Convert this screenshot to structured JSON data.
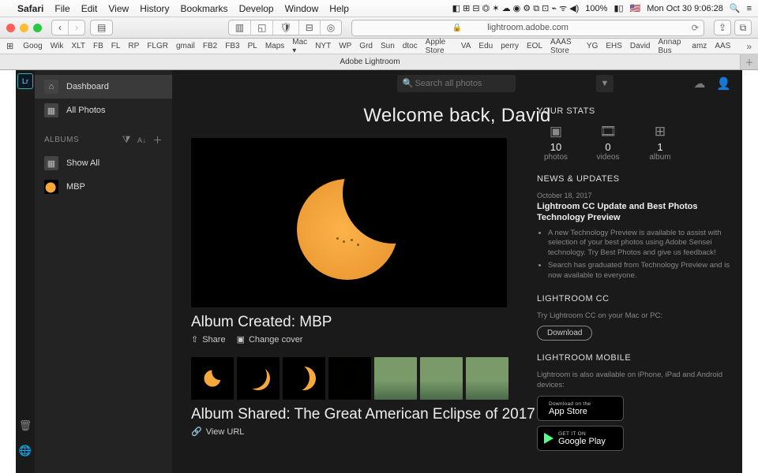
{
  "macmenu": {
    "appname": "Safari",
    "items": [
      "File",
      "Edit",
      "View",
      "History",
      "Bookmarks",
      "Develop",
      "Window",
      "Help"
    ],
    "battery": "100%",
    "flag": "🇺🇸",
    "datetime": "Mon Oct 30  9:06:28"
  },
  "safari": {
    "url": "lightroom.adobe.com",
    "tab_title": "Adobe Lightroom",
    "bookmarks": [
      "Goog",
      "Wik",
      "XLT",
      "FB",
      "FL",
      "RP",
      "FLGR",
      "gmail",
      "FB2",
      "FB3",
      "PL",
      "Maps",
      "Mac ▾",
      "NYT",
      "WP",
      "Grd",
      "Sun",
      "dtoc",
      "Apple Store",
      "VA",
      "Edu",
      "perry",
      "EOL",
      "AAAS Store",
      "YG",
      "EHS",
      "David",
      "Annap Bus",
      "amz",
      "AAS"
    ]
  },
  "app": {
    "logo": "Lr",
    "search_placeholder": "Search all photos"
  },
  "sidebar": {
    "dashboard": "Dashboard",
    "allphotos": "All Photos",
    "albums_hdr": "ALBUMS",
    "showall": "Show All",
    "album1": "MBP"
  },
  "feed": {
    "welcome": "Welcome back, David",
    "card1_title": "Album Created: MBP",
    "share": "Share",
    "change_cover": "Change cover",
    "card2_title": "Album Shared: The Great American Eclipse of 2017",
    "view_url": "View URL"
  },
  "stats": {
    "title": "YOUR STATS",
    "photos_n": "10",
    "photos_l": "photos",
    "videos_n": "0",
    "videos_l": "videos",
    "albums_n": "1",
    "albums_l": "album"
  },
  "news": {
    "title": "NEWS & UPDATES",
    "date": "October 18, 2017",
    "headline": "Lightroom CC Update and Best Photos Technology Preview",
    "b1": "A new Technology Preview is available to assist with selection of your best photos using Adobe Sensei technology. Try Best Photos and give us feedback!",
    "b2": "Search has graduated from Technology Preview and is now available to everyone."
  },
  "lrcc": {
    "title": "LIGHTROOM CC",
    "sub": "Try Lightroom CC on your Mac or PC:",
    "btn": "Download"
  },
  "mobile": {
    "title": "LIGHTROOM MOBILE",
    "sub": "Lightroom is also available on iPhone, iPad and Android devices:",
    "appstore_sm": "Download on the",
    "appstore_bg": "App Store",
    "play_sm": "GET IT ON",
    "play_bg": "Google Play"
  }
}
